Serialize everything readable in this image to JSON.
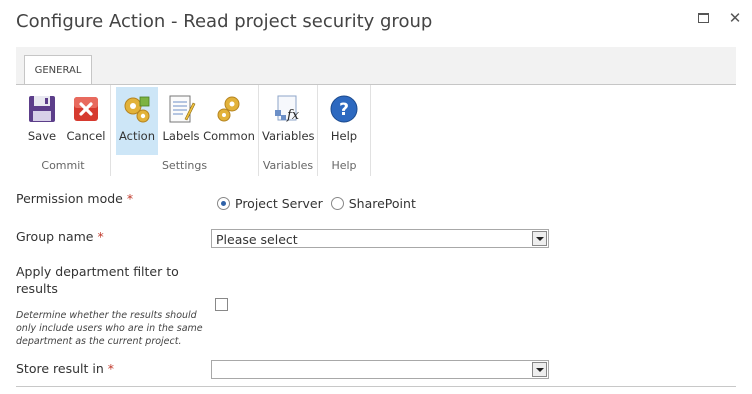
{
  "dialog": {
    "title": "Configure Action - Read project security group",
    "maximize_icon": "maximize-icon",
    "close_icon": "close-icon",
    "close_glyph": "✕"
  },
  "ribbon": {
    "tab": "GENERAL",
    "groups": {
      "commit": {
        "label": "Commit",
        "buttons": {
          "save": {
            "label": "Save",
            "icon": "save-icon"
          },
          "cancel": {
            "label": "Cancel",
            "icon": "cancel-icon"
          }
        }
      },
      "settings": {
        "label": "Settings",
        "buttons": {
          "action": {
            "label": "Action",
            "icon": "action-gears-icon",
            "active": true
          },
          "labels": {
            "label": "Labels",
            "icon": "labels-notepad-icon"
          },
          "common": {
            "label": "Common",
            "icon": "common-gear-icon"
          }
        }
      },
      "variables": {
        "label": "Variables",
        "buttons": {
          "variables": {
            "label": "Variables",
            "icon": "variables-fx-icon"
          }
        }
      },
      "help": {
        "label": "Help",
        "buttons": {
          "help": {
            "label": "Help",
            "icon": "help-icon"
          }
        }
      }
    }
  },
  "form": {
    "permission_mode": {
      "label": "Permission mode",
      "required_marker": "*",
      "options": [
        "Project Server",
        "SharePoint"
      ],
      "selected": "Project Server"
    },
    "group_name": {
      "label": "Group name",
      "required_marker": "*",
      "value": "Please select"
    },
    "department_filter": {
      "label_line1": "Apply department filter to",
      "label_line2": "results",
      "description_line1": "Determine whether the results should",
      "description_line2": "only include users who are in the same",
      "description_line3": "department as the current project.",
      "checked": false
    },
    "store_result": {
      "label": "Store result in",
      "required_marker": "*",
      "value": ""
    }
  },
  "colors": {
    "accent_active": "#cde6f7",
    "required": "#c0392b",
    "radio_dot": "#2f62a8"
  }
}
